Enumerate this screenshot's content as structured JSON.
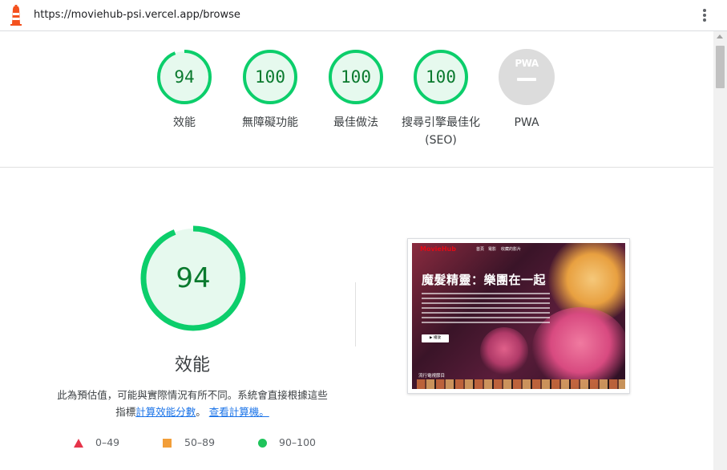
{
  "browser": {
    "url": "https://moviehub-psi.vercel.app/browse",
    "logo_icon": "lighthouse-icon",
    "menu_icon": "kebab-menu-icon"
  },
  "summary": {
    "gauges": [
      {
        "score": "94",
        "label": "效能"
      },
      {
        "score": "100",
        "label": "無障礙功能"
      },
      {
        "score": "100",
        "label": "最佳做法"
      },
      {
        "score": "100",
        "label": "搜尋引擎最佳化",
        "label2": "(SEO)"
      },
      {
        "score": "",
        "label": "PWA",
        "badge_text": "PWA"
      }
    ]
  },
  "performance": {
    "score": "94",
    "title": "效能",
    "note_line1": "此為預估值，可能與實際情況有所不同。系統會直接根據這些",
    "note_prefix": "指標",
    "link_calc": "計算效能分數",
    "note_sep": "。",
    "link_calculator": "查看計算機。",
    "score_fraction": 0.94
  },
  "legend": [
    {
      "range": "0–49",
      "shape": "triangle",
      "color": "#e6344a"
    },
    {
      "range": "50–89",
      "shape": "square",
      "color": "#f29e39"
    },
    {
      "range": "90–100",
      "shape": "circle",
      "color": "#1fc45b"
    }
  ],
  "preview": {
    "logo": "MovieHub",
    "nav_items": [
      "首頁",
      "電影",
      "收藏的影片"
    ],
    "title": "魔髮精靈：樂團在一起",
    "play_button": "▶ 播放",
    "row_label": "流行電視節目"
  },
  "colors": {
    "pass_green": "#0cce6b",
    "pass_bg": "#e6f9ee",
    "pass_text": "#0a7a2e",
    "pwa_grey": "#dcdcdc"
  }
}
